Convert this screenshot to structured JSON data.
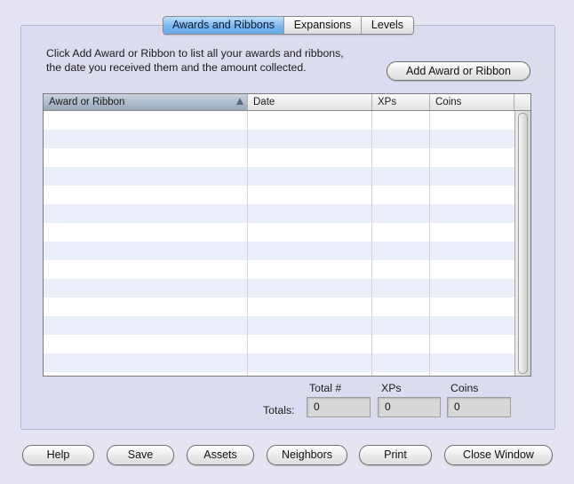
{
  "tabs": [
    "Awards and Ribbons",
    "Expansions",
    "Levels"
  ],
  "instructions": {
    "line1": "Click Add Award or Ribbon to list all your awards and ribbons,",
    "line2": "the date you received them and the amount collected."
  },
  "add_button_label": "Add Award or Ribbon",
  "table": {
    "columns": [
      "Award or Ribbon",
      "Date",
      "XPs",
      "Coins"
    ],
    "sorted_column": "Award or Ribbon",
    "sort_direction": "ascending",
    "rows": []
  },
  "totals": {
    "label": "Totals:",
    "headers": [
      "Total #",
      "XPs",
      "Coins"
    ],
    "total_count": "0",
    "xps": "0",
    "coins": "0"
  },
  "bottom_buttons": [
    "Help",
    "Save",
    "Assets",
    "Neighbors",
    "Print",
    "Close Window"
  ],
  "colors": {
    "background": "#e4e4f3",
    "active_tab": "#79b7ee",
    "row_stripe": "#e9eef8"
  }
}
